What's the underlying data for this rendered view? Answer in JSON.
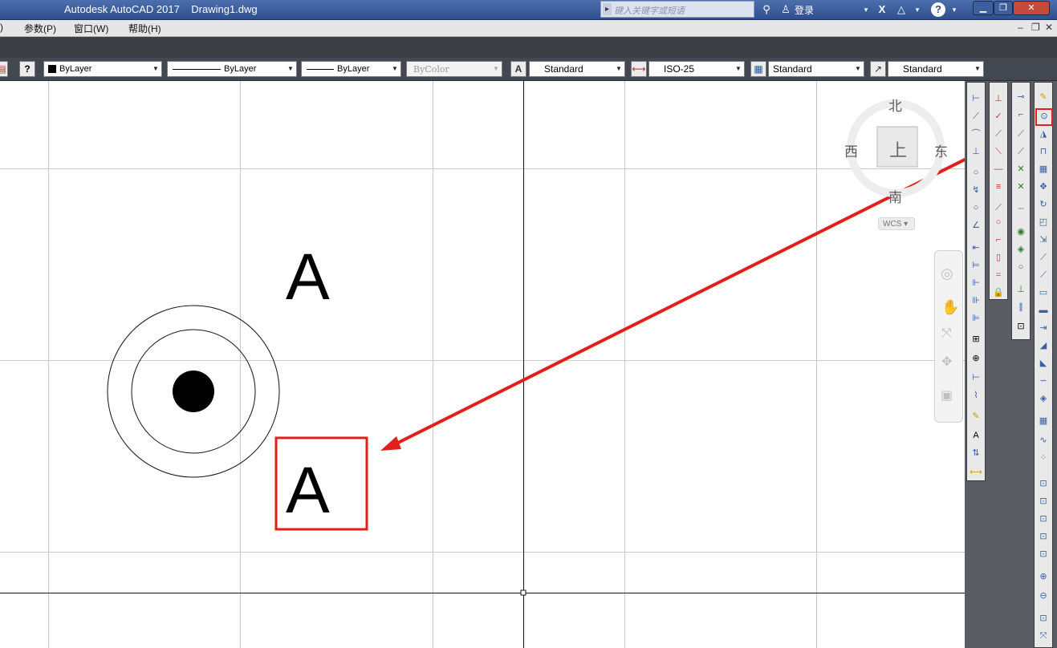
{
  "title_bar": {
    "title": "Autodesk AutoCAD 2017    Drawing1.dwg",
    "search_placeholder": "键入关键字或短语",
    "login_label": "登录",
    "help_label": "?"
  },
  "menu_bar": {
    "items": [
      ")",
      "参数(P)",
      "窗口(W)",
      "帮助(H)"
    ]
  },
  "properties_bar": {
    "help_button": "?",
    "color": "ByLayer",
    "linetype": "ByLayer",
    "lineweight": "ByLayer",
    "plot_style": "ByColor",
    "text_style": "Standard",
    "dim_style": "ISO-25",
    "table_style": "Standard",
    "multileader_style": "Standard"
  },
  "drawing": {
    "text_upper": "A",
    "text_lower": "A"
  },
  "viewcube": {
    "north": "北",
    "south": "南",
    "west": "西",
    "east": "东",
    "top": "上",
    "wcs": "WCS"
  },
  "colors": {
    "highlight_red": "#e0201a",
    "title_bar_blue": "#3a5c9c"
  }
}
